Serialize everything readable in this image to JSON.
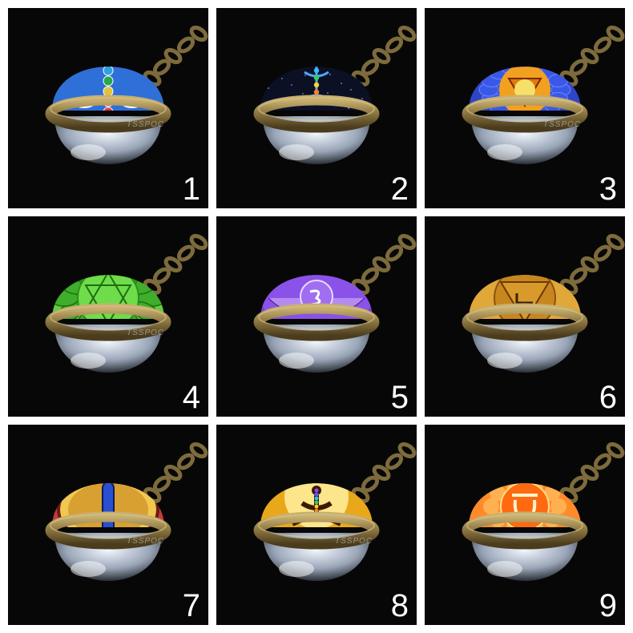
{
  "background_color": "#ffffff",
  "tile_background": "#070707",
  "items": [
    {
      "number": "1",
      "design": "blue face with seven chakra symbols",
      "colors": [
        "#2f6fd8",
        "#27a84a",
        "#e2c23a"
      ],
      "watermark": "TSSPOC"
    },
    {
      "number": "2",
      "design": "meditating figure on dark starry background",
      "colors": [
        "#0b1024",
        "#1c3a7a",
        "#ff3b30"
      ],
      "watermark": ""
    },
    {
      "number": "3",
      "design": "throat chakra blue lotus",
      "colors": [
        "#2f45c8",
        "#f2a020",
        "#f7e06a"
      ],
      "watermark": "TSSPOC"
    },
    {
      "number": "4",
      "design": "heart chakra green lotus",
      "colors": [
        "#5fcf3c",
        "#2f8f1e",
        "#c9f27a"
      ],
      "watermark": "TSSPOC"
    },
    {
      "number": "5",
      "design": "third eye chakra purple",
      "colors": [
        "#7a3fd8",
        "#b48cf0",
        "#e8d8ff"
      ],
      "watermark": ""
    },
    {
      "number": "6",
      "design": "solar plexus chakra golden",
      "colors": [
        "#d89a2a",
        "#b8741a",
        "#f3cf6a"
      ],
      "watermark": ""
    },
    {
      "number": "7",
      "design": "red eye with blue slit pupil",
      "colors": [
        "#c43a3a",
        "#e8b84a",
        "#2a4fd0"
      ],
      "watermark": "TSSPOC"
    },
    {
      "number": "8",
      "design": "meditating silhouette on golden light",
      "colors": [
        "#f5c23a",
        "#7a4a0a",
        "#ffffff"
      ],
      "watermark": "TSSPOC"
    },
    {
      "number": "9",
      "design": "sacral chakra orange",
      "colors": [
        "#ff7a1a",
        "#ffb84a",
        "#ffe08a"
      ],
      "watermark": ""
    }
  ]
}
